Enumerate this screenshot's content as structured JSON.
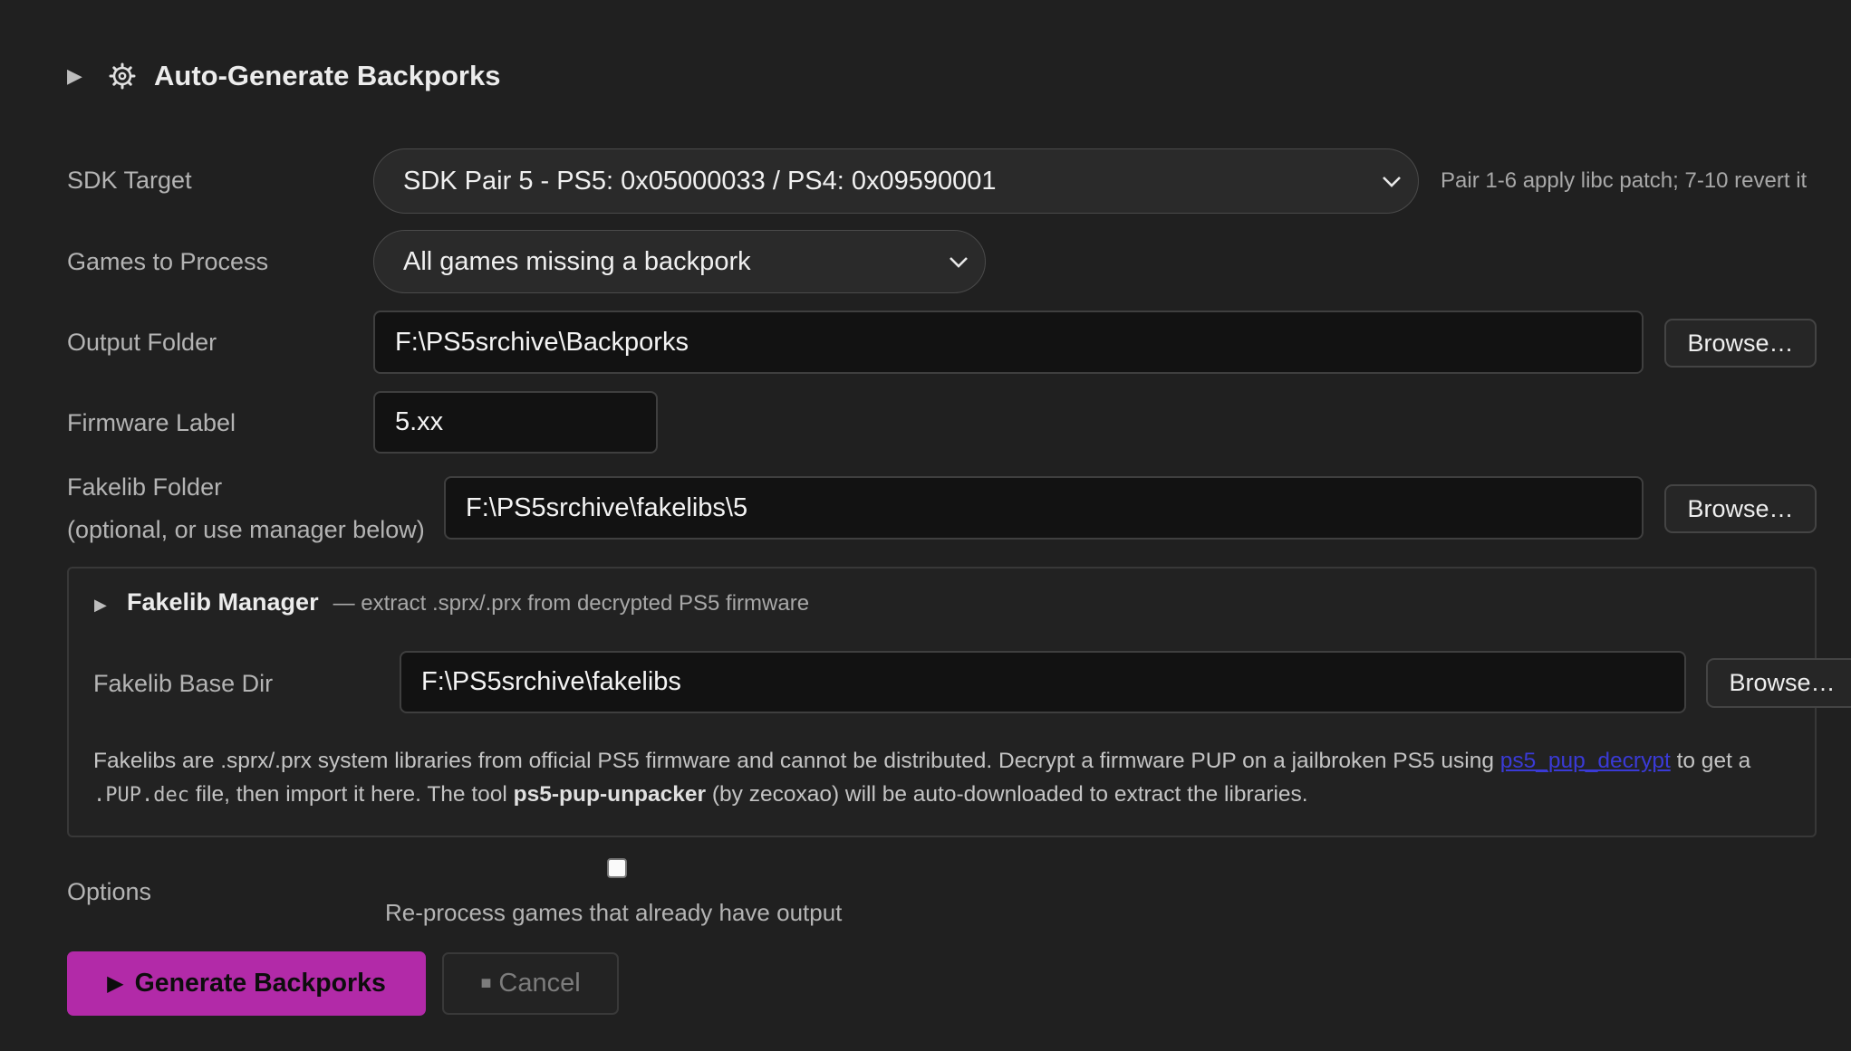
{
  "header": {
    "title": "Auto-Generate Backporks",
    "toggle_icon": "triangle-right-icon",
    "icon": "gear-icon"
  },
  "sdk_target": {
    "label": "SDK Target",
    "value": "SDK Pair 5 - PS5: 0x05000033 / PS4: 0x09590001",
    "hint": "Pair 1-6 apply libc patch; 7-10 revert it"
  },
  "games_to_process": {
    "label": "Games to Process",
    "value": "All games missing a backpork"
  },
  "output_folder": {
    "label": "Output Folder",
    "value": "F:\\PS5srchive\\Backporks",
    "browse_label": "Browse…"
  },
  "firmware_label": {
    "label": "Firmware Label",
    "value": "5.xx"
  },
  "fakelib_folder": {
    "label_line1": "Fakelib Folder",
    "label_line2": "(optional, or use manager below)",
    "value": "F:\\PS5srchive\\fakelibs\\5",
    "browse_label": "Browse…"
  },
  "fakelib_manager": {
    "title": "Fakelib Manager",
    "subtitle": "— extract .sprx/.prx from decrypted PS5 firmware",
    "base_dir_label": "Fakelib Base Dir",
    "base_dir_value": "F:\\PS5srchive\\fakelibs",
    "browse_label": "Browse…",
    "info": {
      "part1": "Fakelibs are .sprx/.prx system libraries from official PS5 firmware and cannot be distributed. Decrypt a firmware PUP on a jailbroken PS5 using ",
      "link": "ps5_pup_decrypt",
      "part2": " to get a",
      "code": ".PUP.dec",
      "part3": " file, then import it here. The tool ",
      "bold": "ps5-pup-unpacker",
      "part4": " (by zecoxao) will be auto-downloaded to extract the libraries."
    }
  },
  "options": {
    "label": "Options",
    "reprocess_label": "Re-process games that already have output",
    "reprocess_checked": false
  },
  "actions": {
    "generate_label": "Generate Backporks",
    "generate_icon": "play-icon",
    "cancel_label": "Cancel",
    "cancel_icon": "stop-icon",
    "generate_color": "#b22aa8"
  }
}
